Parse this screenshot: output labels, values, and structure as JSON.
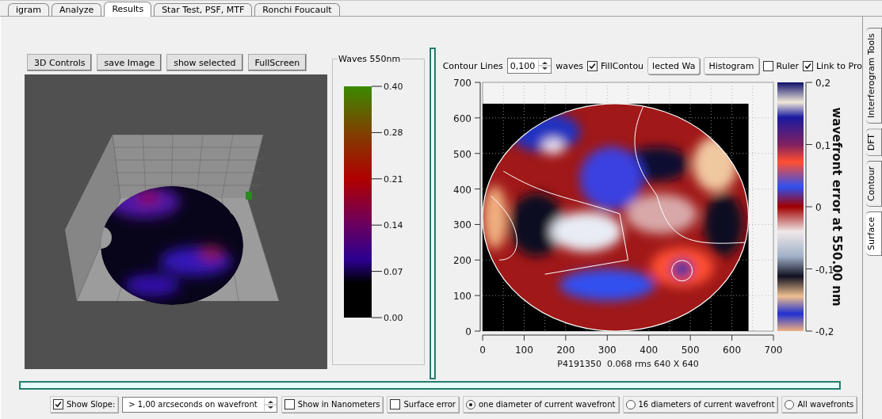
{
  "tabs": [
    {
      "label": "igram",
      "selected": false
    },
    {
      "label": "Analyze",
      "selected": false
    },
    {
      "label": "Results",
      "selected": true
    },
    {
      "label": "Star Test, PSF, MTF",
      "selected": false
    },
    {
      "label": "Ronchi  Foucault",
      "selected": false
    }
  ],
  "side_tabs": [
    {
      "label": "Interferogram Tools",
      "selected": false
    },
    {
      "label": "DFT",
      "selected": false
    },
    {
      "label": "Contour",
      "selected": false
    },
    {
      "label": "Surface",
      "selected": true
    }
  ],
  "view3d": {
    "buttons": [
      "3D Controls",
      "save Image",
      "show selected",
      "FullScreen"
    ]
  },
  "legend": {
    "title": "Waves 550nm",
    "labels": [
      "0.40",
      "0.28",
      "0.21",
      "0.14",
      "0.07",
      "0.00"
    ]
  },
  "contour": {
    "toolbar": [
      {
        "kind": "label",
        "text": "Contour Lines"
      },
      {
        "kind": "spin",
        "value": "0,100"
      },
      {
        "kind": "label",
        "text": "waves"
      },
      {
        "kind": "checkbox",
        "label": "FillContou",
        "checked": true
      },
      {
        "kind": "button",
        "label": "lected Wa"
      },
      {
        "kind": "button",
        "label": "Histogram"
      },
      {
        "kind": "checkbox",
        "label": "Ruler",
        "checked": false
      },
      {
        "kind": "checkbox",
        "label": "Link to Pro",
        "checked": true
      }
    ],
    "yticks": [
      "700",
      "600",
      "500",
      "400",
      "300",
      "200",
      "100",
      "0"
    ],
    "xticks": [
      "0",
      "100",
      "200",
      "300",
      "400",
      "500",
      "600",
      "700"
    ],
    "colorbar_ticks": [
      "0,2",
      "0,1",
      "0",
      "-0,1",
      "-0,2"
    ],
    "colorbar_title": "wavefront error at 550.00 nm",
    "caption": "P4191350  0.068 rms 640 X 640"
  },
  "bottom_bar": [
    {
      "kind": "checkbox",
      "label": "Show Slope:",
      "checked": true
    },
    {
      "kind": "spin",
      "value": "> 1,00 arcseconds on wavefront"
    },
    {
      "kind": "checkbox",
      "label": "Show in Nanometers",
      "checked": false
    },
    {
      "kind": "checkbox",
      "label": "Surface error",
      "checked": false
    },
    {
      "kind": "radio",
      "label": "one diameter of current wavefront",
      "selected": true
    },
    {
      "kind": "radio",
      "label": "16 diameters of current wavefront",
      "selected": false
    },
    {
      "kind": "radio",
      "label": "All wavefronts",
      "selected": false
    }
  ]
}
